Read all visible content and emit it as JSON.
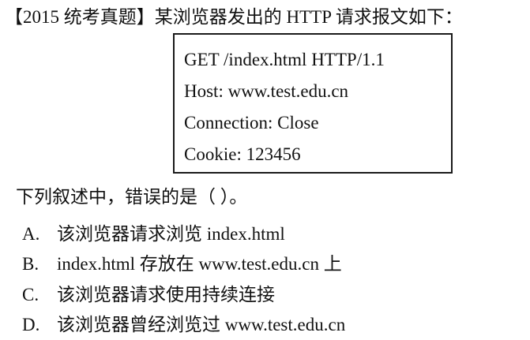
{
  "question_title": "【2015 统考真题】某浏览器发出的 HTTP 请求报文如下：",
  "request_lines": [
    "GET /index.html HTTP/1.1",
    "Host: www.test.edu.cn",
    "Connection: Close",
    "Cookie: 123456"
  ],
  "question_stem": "下列叙述中，错误的是（ ）。",
  "options": [
    {
      "letter": "A.",
      "text": "该浏览器请求浏览 index.html"
    },
    {
      "letter": "B.",
      "text": "index.html 存放在 www.test.edu.cn 上"
    },
    {
      "letter": "C.",
      "text": "该浏览器请求使用持续连接"
    },
    {
      "letter": "D.",
      "text": "该浏览器曾经浏览过 www.test.edu.cn"
    }
  ]
}
